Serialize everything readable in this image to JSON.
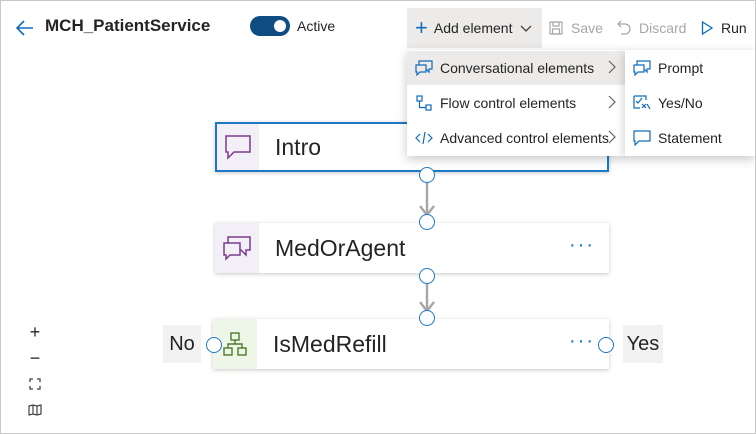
{
  "header": {
    "title": "MCH_PatientService",
    "active_label": "Active",
    "active_on": true
  },
  "toolbar": {
    "add_label": "Add element",
    "save_label": "Save",
    "discard_label": "Discard",
    "run_label": "Run"
  },
  "add_menu": {
    "items": [
      {
        "label": "Conversational elements",
        "icon": "conversation-icon"
      },
      {
        "label": "Flow control elements",
        "icon": "flow-icon"
      },
      {
        "label": "Advanced control elements",
        "icon": "code-icon"
      }
    ]
  },
  "sub_menu": {
    "items": [
      {
        "label": "Prompt",
        "icon": "prompt-icon"
      },
      {
        "label": "Yes/No",
        "icon": "yes-no-icon"
      },
      {
        "label": "Statement",
        "icon": "statement-icon"
      }
    ]
  },
  "nodes": [
    {
      "label": "Intro",
      "icon": "statement-node-icon"
    },
    {
      "label": "MedOrAgent",
      "icon": "prompt-node-icon",
      "more": "···"
    },
    {
      "label": "IsMedRefill",
      "icon": "flow-node-icon",
      "more": "···"
    }
  ],
  "branches": {
    "no": "No",
    "yes": "Yes"
  },
  "zoom": {
    "zoom_in": "+",
    "zoom_out": "−"
  },
  "colors": {
    "accent": "#0f6cbd",
    "toggle": "#0f4c81",
    "selected_border": "#1e78c8",
    "prompt_icon": "#7a3b8e",
    "flow_icon": "#4c7a2e"
  }
}
